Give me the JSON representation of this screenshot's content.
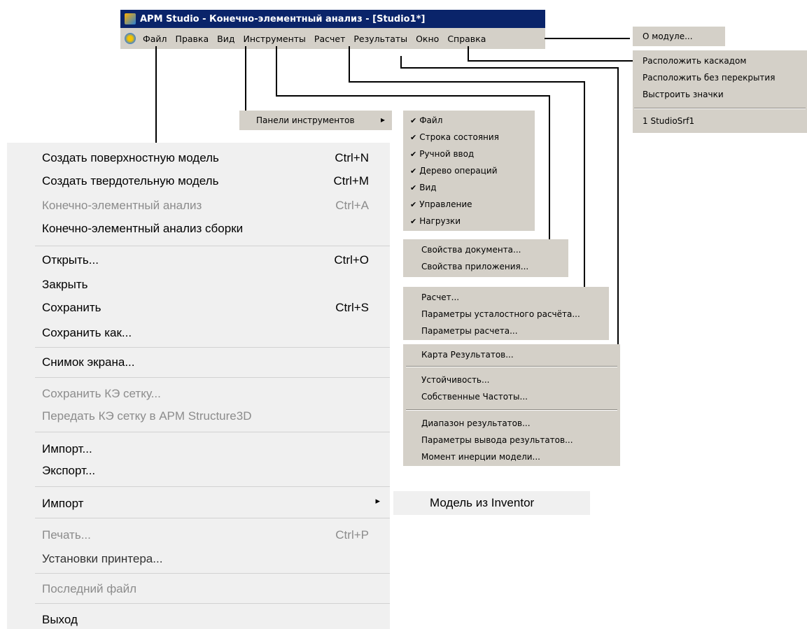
{
  "window": {
    "title": "APM Studio - Конечно-элементный анализ - [Studio1*]"
  },
  "menubar": {
    "items": [
      "Файл",
      "Правка",
      "Вид",
      "Инструменты",
      "Расчет",
      "Результаты",
      "Окно",
      "Справка"
    ]
  },
  "help_menu": {
    "about": "О модуле..."
  },
  "window_menu": {
    "cascade": "Расположить каскадом",
    "tile": "Расположить без перекрытия",
    "arrange_icons": "Выстроить значки",
    "doc1": "1 StudioSrf1"
  },
  "view_menu": {
    "toolbars": "Панели инструментов",
    "arrow": "▸"
  },
  "toolbars_submenu": {
    "check": "✔",
    "items": [
      "Файл",
      "Строка состояния",
      "Ручной ввод",
      "Дерево операций",
      "Вид",
      "Управление",
      "Нагрузки"
    ]
  },
  "tools_menu": {
    "doc_props": "Свойства документа...",
    "app_props": "Свойства приложения..."
  },
  "calc_menu": {
    "calc": "Расчет...",
    "fatigue": "Параметры усталостного расчёта...",
    "params": "Параметры расчета..."
  },
  "results_menu": {
    "map": "Карта Результатов...",
    "stability": "Устойчивость...",
    "frequencies": "Собственные Частоты...",
    "range": "Диапазон результатов...",
    "output_params": "Параметры вывода результатов...",
    "inertia": "Момент инерции модели..."
  },
  "file_menu": {
    "new_surface": {
      "label": "Создать поверхностную модель",
      "shortcut": "Ctrl+N"
    },
    "new_solid": {
      "label": "Создать твердотельную модель",
      "shortcut": "Ctrl+M"
    },
    "fe_analysis": {
      "label": "Конечно-элементный анализ",
      "shortcut": "Ctrl+A"
    },
    "fe_assembly": {
      "label": "Конечно-элементный анализ сборки"
    },
    "open": {
      "label": "Открыть...",
      "shortcut": "Ctrl+O"
    },
    "close": {
      "label": "Закрыть"
    },
    "save": {
      "label": "Сохранить",
      "shortcut": "Ctrl+S"
    },
    "save_as": {
      "label": "Сохранить как..."
    },
    "screenshot": {
      "label": "Снимок экрана..."
    },
    "save_mesh": {
      "label": "Сохранить КЭ сетку..."
    },
    "send_mesh": {
      "label": "Передать КЭ сетку в APM Structure3D"
    },
    "import": {
      "label": "Импорт..."
    },
    "export": {
      "label": "Экспорт..."
    },
    "import_sub": {
      "label": "Импорт",
      "arrow": "▸"
    },
    "print": {
      "label": "Печать...",
      "shortcut": "Ctrl+P"
    },
    "printer_setup": {
      "label": "Установки принтера..."
    },
    "recent": {
      "label": "Последний файл"
    },
    "exit": {
      "label": "Выход"
    }
  },
  "import_submenu": {
    "inventor": "Модель из Inventor"
  }
}
